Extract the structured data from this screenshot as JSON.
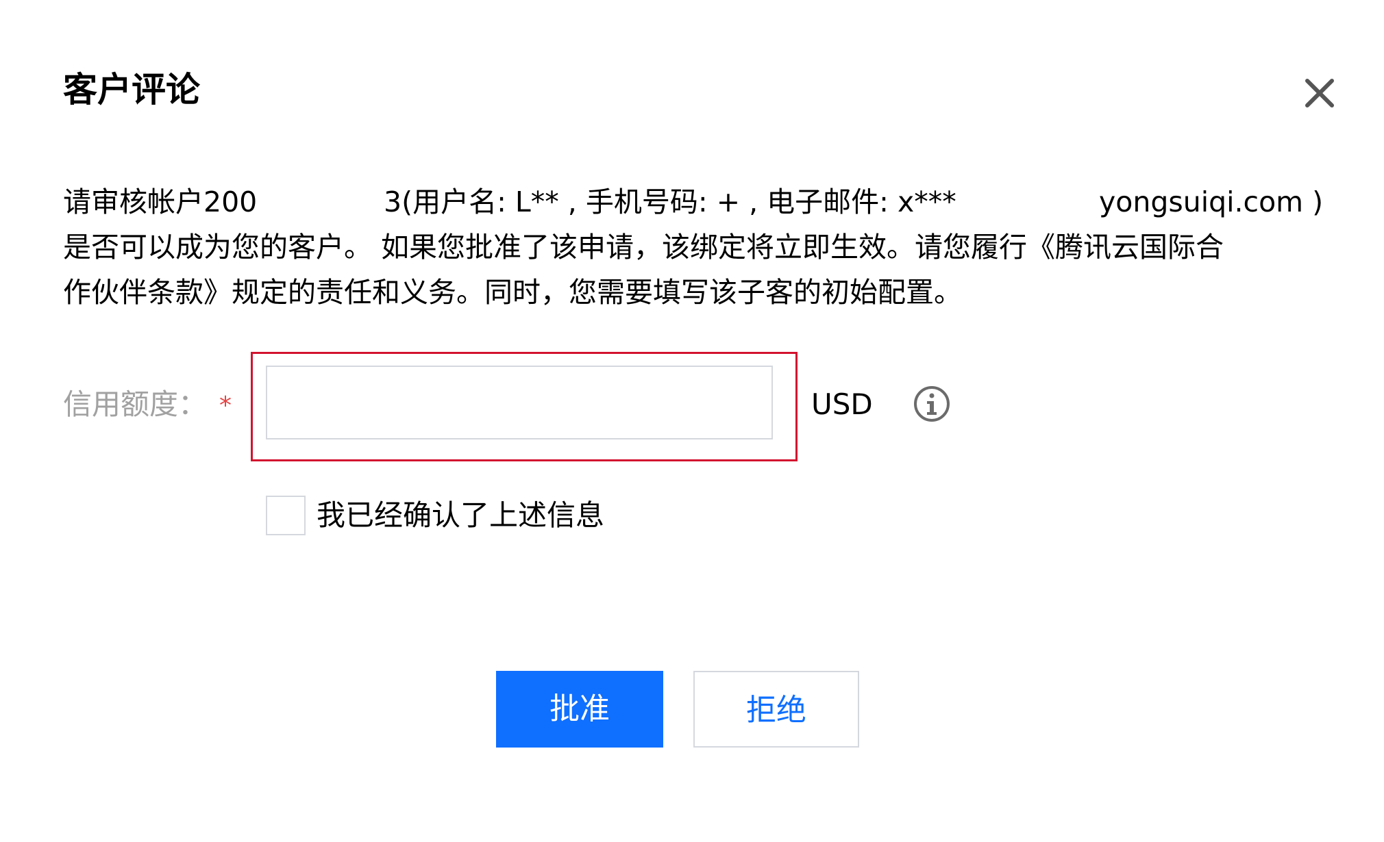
{
  "dialog": {
    "title": "客户评论",
    "close_icon": "close-icon"
  },
  "description": {
    "line1_prefix": "请审核帐户200",
    "line1_middle": "3(用户名: L** , 手机号码: + , 电子邮件: x***",
    "line1_suffix": "yongsuiqi.com )",
    "line2": "是否可以成为您的客户。 如果您批准了该申请，该绑定将立即生效。请您履行《腾讯云国际合",
    "line3": "作伙伴条款》规定的责任和义务。同时，您需要填写该子客的初始配置。"
  },
  "form": {
    "credit_label": "信用额度：",
    "required_mark": "*",
    "credit_value": "",
    "credit_placeholder": "",
    "currency": "USD",
    "info_icon": "info-icon",
    "confirm_label": "我已经确认了上述信息",
    "confirm_checked": false
  },
  "actions": {
    "approve_label": "批准",
    "reject_label": "拒绝"
  },
  "colors": {
    "primary": "#0f6fff",
    "highlight_border": "#d3122e",
    "required": "#e54545",
    "label_gray": "#a1a1a1"
  }
}
